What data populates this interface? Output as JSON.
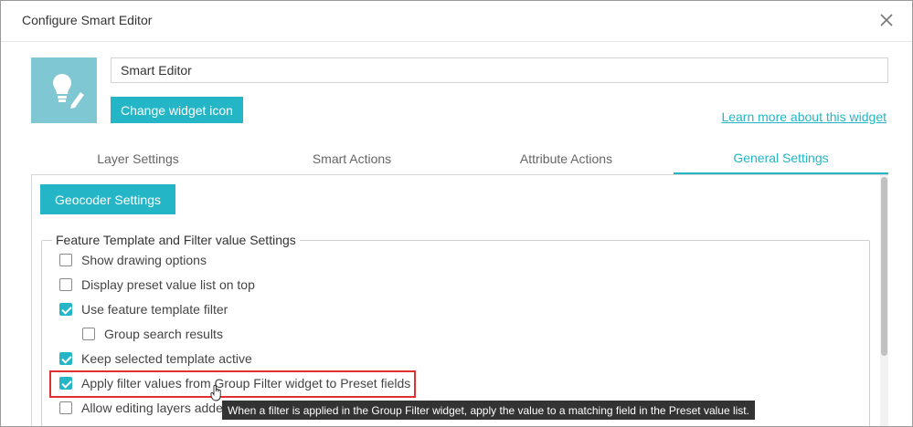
{
  "dialog": {
    "title": "Configure Smart Editor"
  },
  "widget": {
    "name_value": "Smart Editor",
    "change_icon_label": "Change widget icon",
    "learn_more_label": "Learn more about this widget",
    "icon": "lightbulb-pencil-icon"
  },
  "tabs": [
    {
      "label": "Layer Settings"
    },
    {
      "label": "Smart Actions"
    },
    {
      "label": "Attribute Actions"
    },
    {
      "label": "General Settings"
    }
  ],
  "active_tab": "General Settings",
  "general": {
    "geocoder_label": "Geocoder Settings",
    "section_title": "Feature Template and Filter value Settings",
    "options": [
      {
        "label": "Show drawing options",
        "checked": false
      },
      {
        "label": "Display preset value list on top",
        "checked": false
      },
      {
        "label": "Use feature template filter",
        "checked": true
      },
      {
        "label": "Group search results",
        "checked": false
      },
      {
        "label": "Keep selected template active",
        "checked": true
      },
      {
        "label": "Apply filter values from Group Filter widget to Preset fields",
        "checked": true
      },
      {
        "label": "Allow editing layers adde",
        "checked": false
      }
    ]
  },
  "tooltip": "When a filter is applied in the Group Filter widget, apply the value to a matching field in the Preset value list.",
  "colors": {
    "accent": "#24b5c6",
    "icon_tile": "#7fc7d2",
    "highlight": "#e0302f",
    "tooltip_bg": "#333333"
  }
}
